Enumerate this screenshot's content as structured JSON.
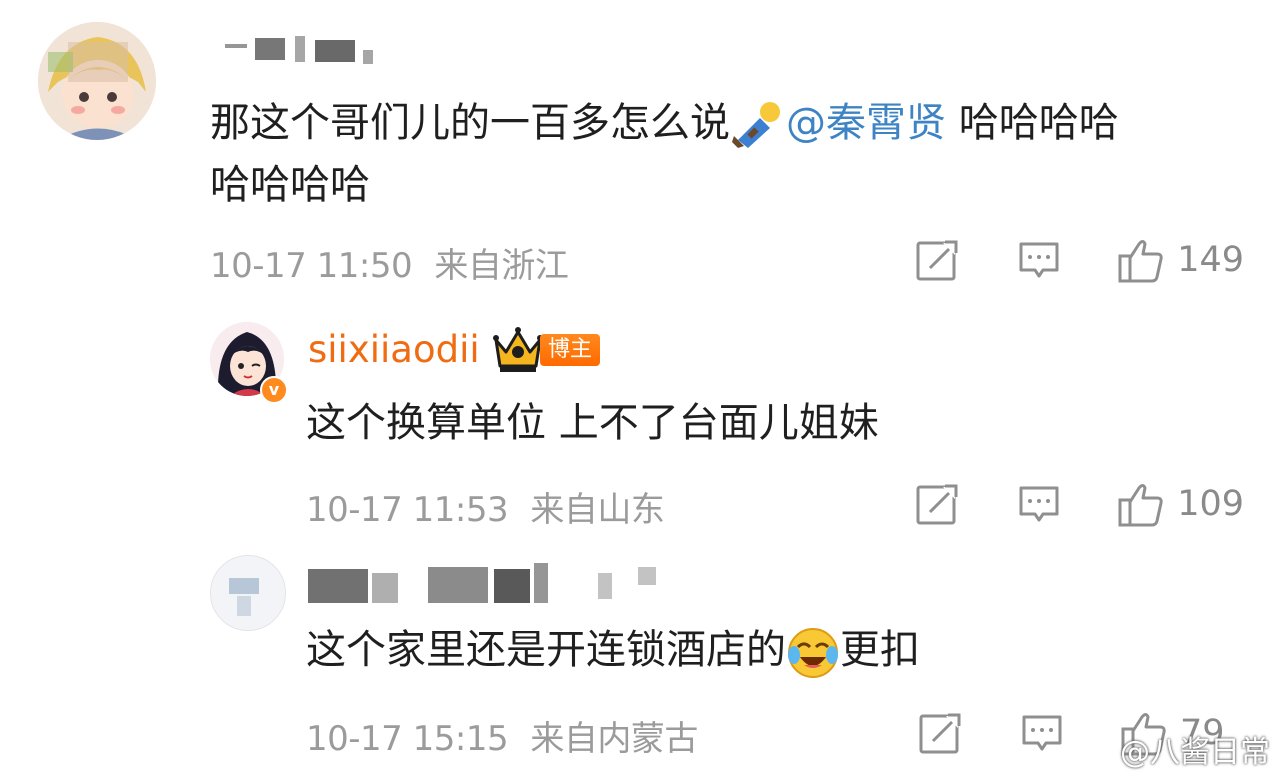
{
  "comments": [
    {
      "username": "",
      "content_text": "那这个哥们儿的一百多怎么说",
      "mention": "@秦霄贤",
      "content_tail": " 哈哈哈哈",
      "content_line2": "哈哈哈哈",
      "time": "10-17 11:50",
      "location": "来自浙江",
      "likes": "149",
      "icons": [
        "forward-icon",
        "reply-icon",
        "like-icon"
      ]
    },
    {
      "username": "siixiiaodii",
      "badge": "博主",
      "content_text": "这个换算单位 上不了台面儿姐妹",
      "time": "10-17 11:53",
      "location": "来自山东",
      "likes": "109",
      "icons": [
        "forward-icon",
        "reply-icon",
        "like-icon"
      ]
    },
    {
      "username": "",
      "content_text": "这个家里还是开连锁酒店的",
      "content_tail": "更扣",
      "time": "10-17 15:15",
      "location": "来自内蒙古",
      "likes": "79",
      "icons": [
        "forward-icon",
        "reply-icon",
        "like-icon"
      ]
    }
  ],
  "watermark": "@八酱日常",
  "colors": {
    "accent_mention": "#3e84c4",
    "username_orange": "#f06c12",
    "meta_gray": "#9b9b9b",
    "badge_orange": "#ff7a00"
  }
}
